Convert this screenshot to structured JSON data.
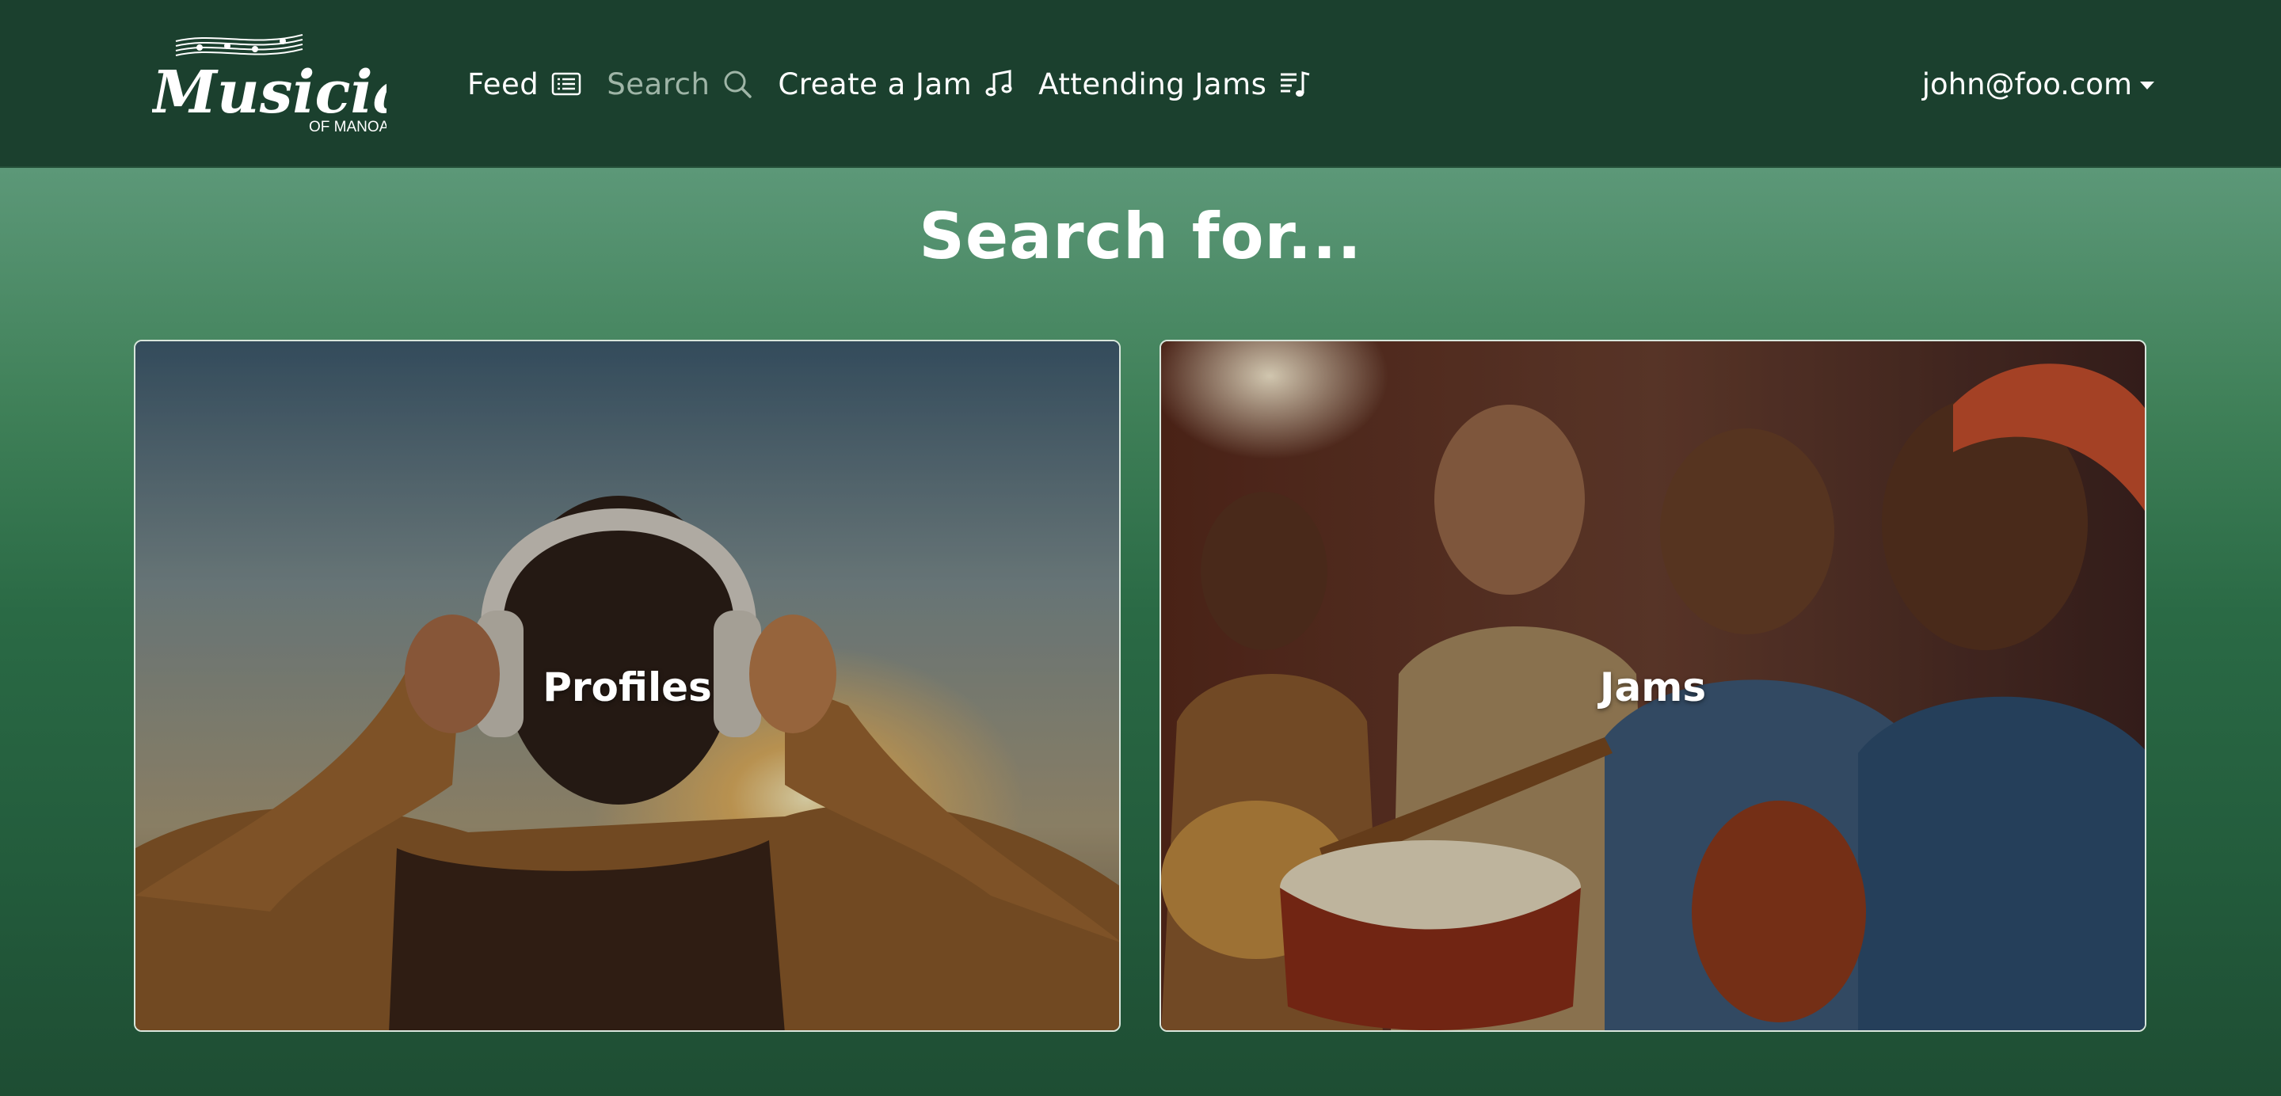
{
  "brand": {
    "logo_text": "Musicians",
    "logo_subtext": "OF MANOA"
  },
  "nav": {
    "items": [
      {
        "label": "Feed",
        "icon": "list-icon",
        "active": false
      },
      {
        "label": "Search",
        "icon": "search-icon",
        "active": true
      },
      {
        "label": "Create a Jam",
        "icon": "music-note-icon",
        "active": false
      },
      {
        "label": "Attending Jams",
        "icon": "music-playlist-icon",
        "active": false
      }
    ],
    "user": "john@foo.com"
  },
  "page": {
    "title": "Search for..."
  },
  "cards": [
    {
      "label": "Profiles"
    },
    {
      "label": "Jams"
    }
  ],
  "colors": {
    "navbar": "#1b402e",
    "active_nav": "#9fb5a7",
    "text": "#ffffff"
  }
}
